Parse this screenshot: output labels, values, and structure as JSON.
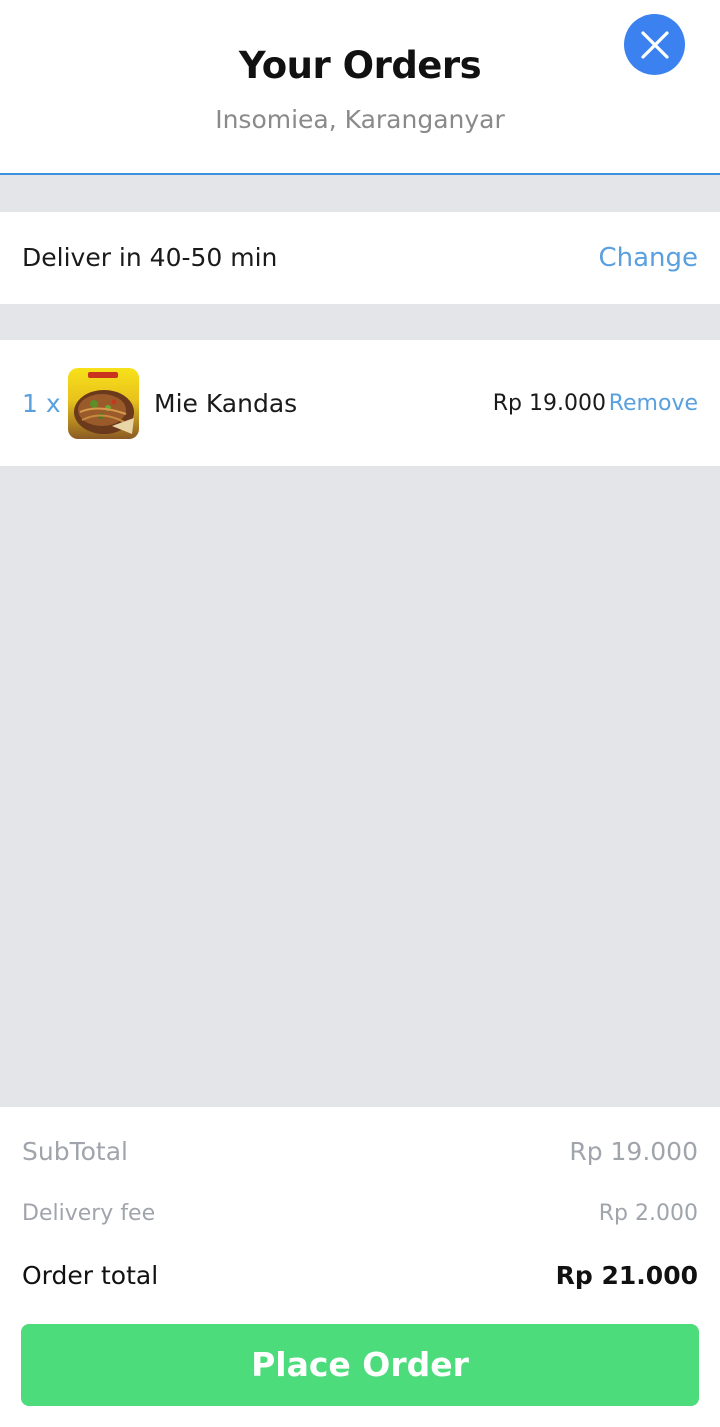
{
  "header": {
    "title": "Your Orders",
    "subtitle": "Insomiea, Karanganyar",
    "close_icon": "close-icon",
    "accent_color": "#3b82f0"
  },
  "delivery": {
    "label": "Deliver in 40-50 min",
    "change_label": "Change"
  },
  "items": [
    {
      "quantity": "1 x",
      "name": "Mie Kandas",
      "price": "Rp 19.000",
      "remove_label": "Remove"
    }
  ],
  "summary": {
    "subtotal_label": "SubTotal",
    "subtotal_value": "Rp 19.000",
    "delivery_fee_label": "Delivery fee",
    "delivery_fee_value": "Rp 2.000",
    "order_total_label": "Order total",
    "order_total_value": "Rp 21.000"
  },
  "actions": {
    "place_order_label": "Place Order",
    "place_order_color": "#4cdc7c",
    "link_color": "#5aa0df"
  }
}
